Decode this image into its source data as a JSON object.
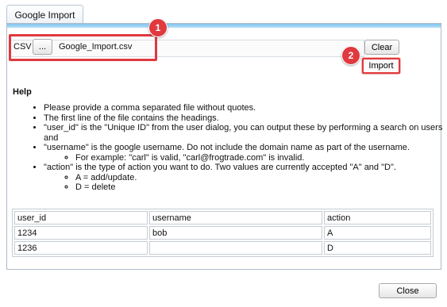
{
  "tab": {
    "label": "Google Import"
  },
  "toolbar": {
    "csv_label": "CSV",
    "browse_label": "...",
    "filename": "Google_Import.csv",
    "clear_label": "Clear",
    "import_label": "Import"
  },
  "annotations": {
    "badge1": "1",
    "badge2": "2",
    "color": "#e0393e"
  },
  "help": {
    "title": "Help",
    "items": [
      "Please provide a comma separated file without quotes.",
      "The first line of the file contains the headings.",
      "\"user_id\" is the \"Unique ID\" from the user dialog, you can output these by performing a search on users and",
      "\"username\" is the google username. Do not include the domain name as part of the username.",
      "\"action\" is the type of action you want to do. Two values are currently accepted \"A\" and \"D\"."
    ],
    "username_example": "For example: \"carl\" is valid, \"carl@frogtrade.com\" is invalid.",
    "action_values": [
      "A = add/update.",
      "D = delete"
    ]
  },
  "table": {
    "headers": [
      "user_id",
      "username",
      "action"
    ],
    "rows": [
      [
        "1234",
        "bob",
        "A"
      ],
      [
        "1236",
        "",
        "D"
      ]
    ]
  },
  "footer": {
    "close_label": "Close"
  }
}
